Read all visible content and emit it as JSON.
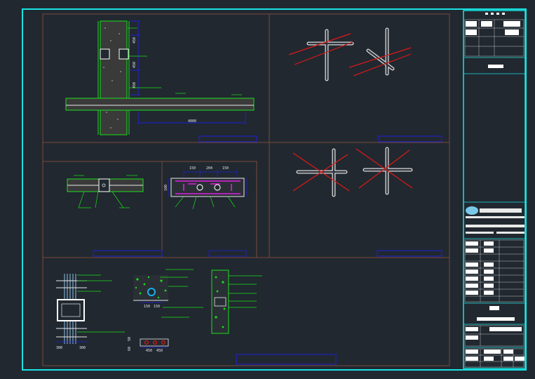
{
  "drawing": {
    "colors": {
      "background": "#212830",
      "border": "#19e3e3",
      "panel_frame": "#7a4a3a",
      "concrete_outline": "#19e019",
      "concrete_fill": "#3a3a3a",
      "annotation": "#2020d8",
      "rebar": "#e020e0",
      "cross_out": "#e01818",
      "pipe": "#d8d8d8",
      "text": "#e8e8e8"
    },
    "dimensions": {
      "wall_h1": "450",
      "wall_h2": "450",
      "wall_h3": "450",
      "slab_span": "4000",
      "d_150a": "150",
      "d_204": "204",
      "d_150b": "150",
      "d_100": "100",
      "d_300a": "300",
      "d_300b": "300",
      "d_150c": "150",
      "d_150d": "150",
      "d_450a": "450",
      "d_450b": "450",
      "d_50": "50",
      "d_60": "60"
    }
  }
}
